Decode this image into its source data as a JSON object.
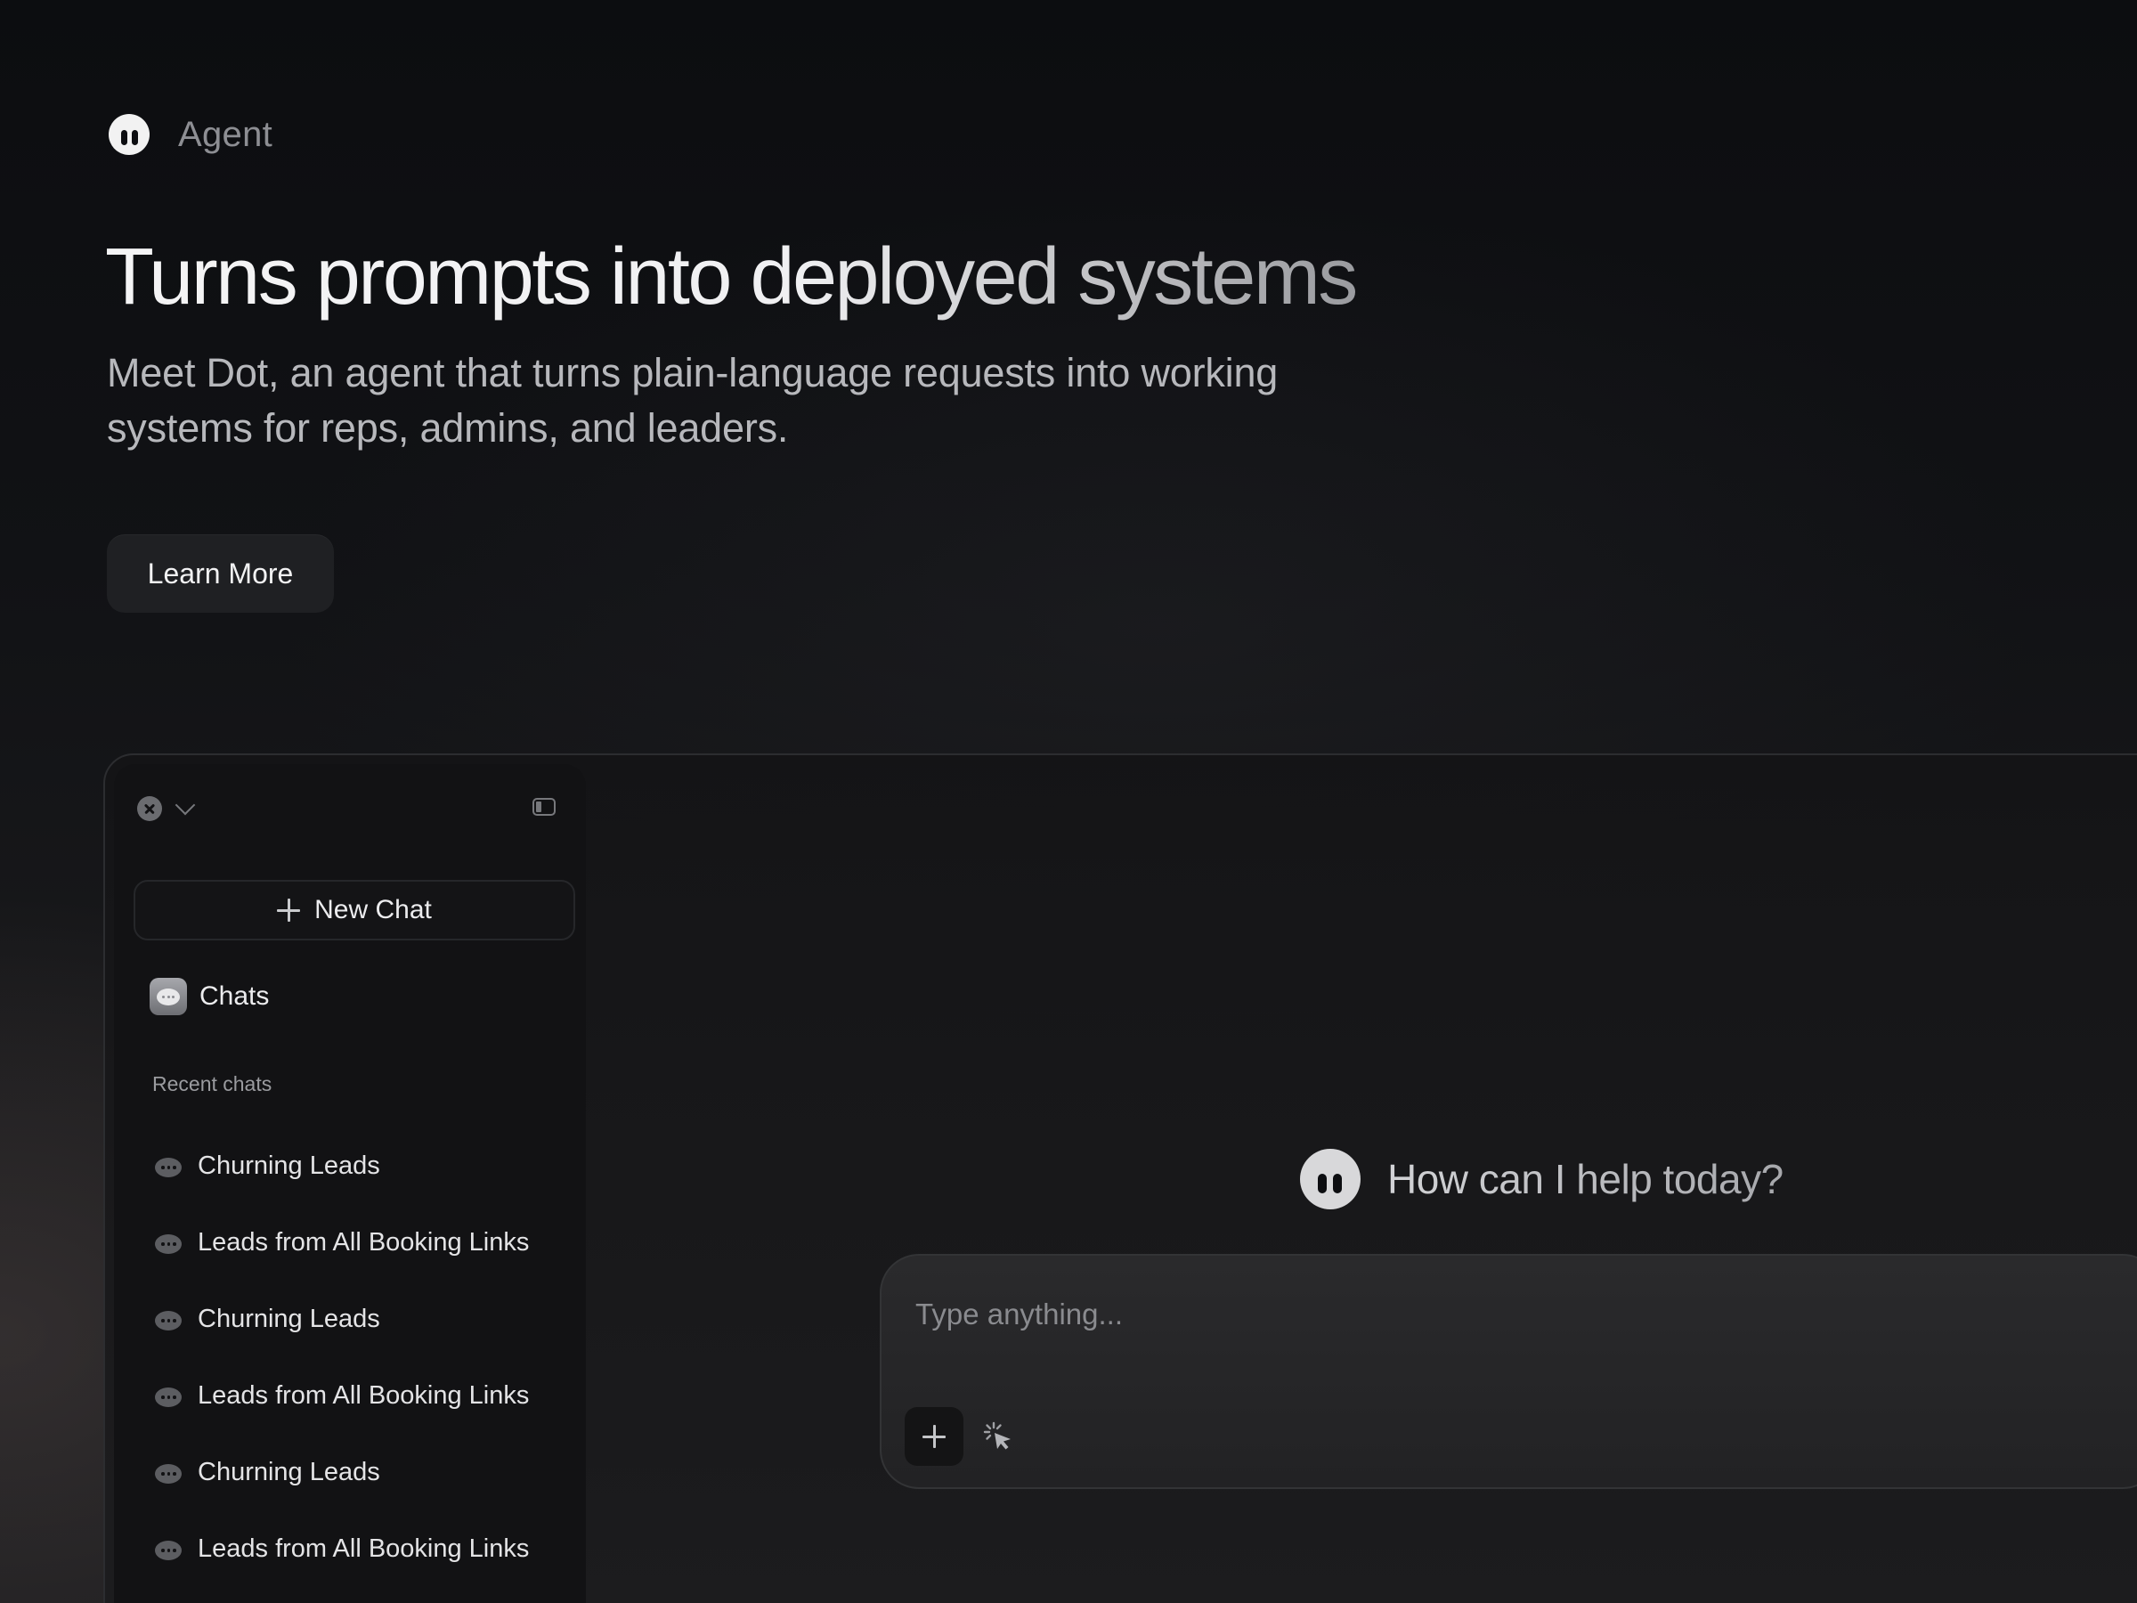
{
  "brand": {
    "name": "Agent"
  },
  "hero": {
    "title": "Turns prompts into deployed systems",
    "subtitle": "Meet Dot, an agent that turns plain-language requests into working systems for reps, admins, and leaders.",
    "cta_label": "Learn More"
  },
  "sidebar": {
    "new_chat_label": "New Chat",
    "chats_label": "Chats",
    "recent_label": "Recent chats",
    "recent_chats": [
      "Churning Leads",
      "Leads from All Booking Links",
      "Churning Leads",
      "Leads from All Booking Links",
      "Churning Leads",
      "Leads from All Booking Links"
    ]
  },
  "main": {
    "greeting": "How can I help today?",
    "input_placeholder": "Type anything..."
  }
}
